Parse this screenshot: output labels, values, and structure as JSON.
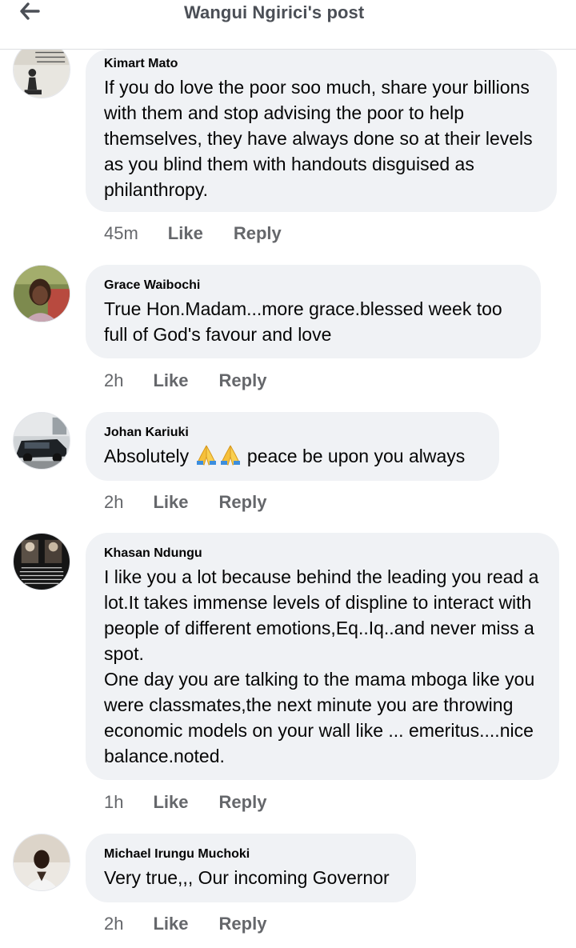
{
  "header": {
    "title": "Wangui Ngirici's post",
    "back_icon": "back-arrow-icon"
  },
  "colors": {
    "bubble_bg": "#f0f2f5",
    "meta_text": "#65676b",
    "header_text": "#4b4f56"
  },
  "comments": [
    {
      "author": "Kimart Mato",
      "text": "If you do love the poor soo much, share your billions with them and stop advising the poor to help themselves, they have always done so at their levels as you blind them with handouts disguised as philanthropy.",
      "time": "45m",
      "like_label": "Like",
      "reply_label": "Reply"
    },
    {
      "author": "Grace Waibochi",
      "text": "True Hon.Madam...more grace.blessed week too full of God's favour and love",
      "time": "2h",
      "like_label": "Like",
      "reply_label": "Reply"
    },
    {
      "author": "Johan Kariuki",
      "text_before": "Absolutely",
      "emoji": "folded-hands-emoji",
      "text_after": "peace be upon you always",
      "time": "2h",
      "like_label": "Like",
      "reply_label": "Reply"
    },
    {
      "author": "Khasan Ndungu",
      "text": "I like you a lot because behind the leading you read a lot.It takes immense levels of displine to interact with people of different emotions,Eq..Iq..and never miss a spot.\nOne day you are talking to the mama mboga like you were classmates,the next minute you are throwing economic models on your wall like ... emeritus....nice balance.noted.",
      "time": "1h",
      "like_label": "Like",
      "reply_label": "Reply"
    },
    {
      "author": "Michael Irungu Muchoki",
      "text": "Very true,,, Our incoming Governor",
      "time": "2h",
      "like_label": "Like",
      "reply_label": "Reply"
    }
  ]
}
